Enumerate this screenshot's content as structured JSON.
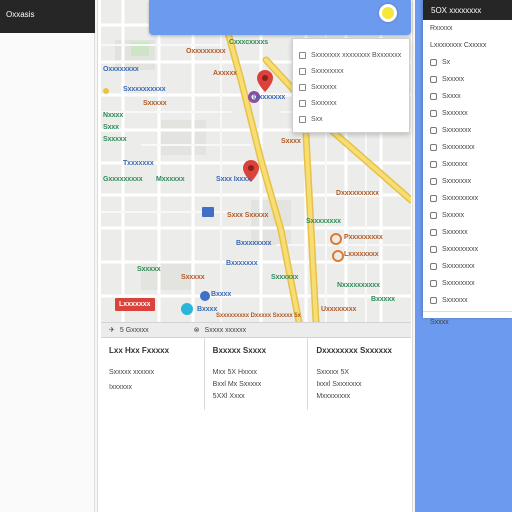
{
  "left_panel": {
    "title": "Oxxasis"
  },
  "map": {
    "labels": [
      {
        "text": "Cxxxcxxxxs",
        "color": "green"
      },
      {
        "text": "Oxxxxxxxxx",
        "color": "brown"
      },
      {
        "text": "Axxxxx",
        "color": "brown"
      },
      {
        "text": "Oxxxxxxxx",
        "color": "blue"
      },
      {
        "text": "Sxxxxxxxxxx",
        "color": "blue"
      },
      {
        "text": "Ixxxxxxxx",
        "color": "blue"
      },
      {
        "text": "Sxxxxx",
        "color": "brown"
      },
      {
        "text": "Nxxxx",
        "color": "green"
      },
      {
        "text": "Sxxx",
        "color": "green"
      },
      {
        "text": "Sxxxxx",
        "color": "green"
      },
      {
        "text": "Sxxxx",
        "color": "brown"
      },
      {
        "text": "Txxxxxxx",
        "color": "blue"
      },
      {
        "text": "Mxxxxxx",
        "color": "green"
      },
      {
        "text": "Gxxxxxxxxx",
        "color": "green"
      },
      {
        "text": "Sxxx Ixxxx",
        "color": "blue"
      },
      {
        "text": "Sxxx Sxxxxx",
        "color": "brown"
      },
      {
        "text": "Dxxxxxxxxxx",
        "color": "brown"
      },
      {
        "text": "Sxxxxxxxx",
        "color": "green"
      },
      {
        "text": "Bxxxxxxxx",
        "color": "blue"
      },
      {
        "text": "Bxxxxxxx",
        "color": "blue"
      },
      {
        "text": "Sxxxxx",
        "color": "green"
      },
      {
        "text": "Pxxxxxxxxx",
        "color": "brown"
      },
      {
        "text": "Lxxxxxxxx",
        "color": "brown"
      },
      {
        "text": "Sxxxxx",
        "color": "brown"
      },
      {
        "text": "Sxxxxxx",
        "color": "green"
      },
      {
        "text": "Bxxxx",
        "color": "blue"
      },
      {
        "text": "Bxxxx",
        "color": "blue"
      },
      {
        "text": "Nxxxxxxxxxx",
        "color": "green"
      },
      {
        "text": "Bxxxxx",
        "color": "green"
      },
      {
        "text": "Uxxxxxxxx",
        "color": "brown"
      },
      {
        "text": "Sxxxxxxxxx Dxxxxx Sxxxxx 5x",
        "color": "brown"
      }
    ],
    "red_badge": "Lxxxxxxx",
    "colors": {
      "road_major": "#f0d568",
      "road_minor": "#ffffff",
      "bg": "#ececea",
      "accent_blue": "#6b9aee"
    }
  },
  "dropdown": {
    "items": [
      "Sxxxxxxx xxxxxxxx Bxxxxxxx",
      "Sxxxxxxxx",
      "Sxxxxxx",
      "Sxxxxxx",
      "Sxx"
    ]
  },
  "strip": {
    "left": "5 Gxxxxx",
    "right": "Sxxxx xxxxxx"
  },
  "info": {
    "columns": [
      {
        "heading": "Lxx Hxx Fxxxxx",
        "lines": [
          "Sxxxxx xxxxxx",
          "Ixxxxxx"
        ]
      },
      {
        "heading": "Bxxxxx Sxxxx",
        "lines": [
          "Mxx 5X Hxxxx",
          "Bxxl Mx Sxxxxx",
          "5XXl Xxxx"
        ]
      },
      {
        "heading": "Dxxxxxxxx Sxxxxxx",
        "lines": [
          "Sxxxxx 5X",
          "Ixxxl Sxxxxxxx",
          "Mxxxxxxxx"
        ]
      }
    ]
  },
  "right_panel": {
    "title": "5OX xxxxxxxx",
    "items": [
      "Rxxxxx",
      "Lxxxxxxxx Cxxxxx",
      "Sx",
      "Sxxxxx",
      "Sxxxx",
      "Sxxxxxx",
      "Sxxxxxxx",
      "Sxxxxxxxx",
      "Sxxxxxx",
      "Sxxxxxxx",
      "Sxxxxxxxxx",
      "Sxxxxx",
      "Sxxxxxx",
      "Sxxxxxxxxx",
      "Sxxxxxxxx",
      "Sxxxxxxxx",
      "Sxxxxxx"
    ],
    "footer": "Sxxxx"
  }
}
